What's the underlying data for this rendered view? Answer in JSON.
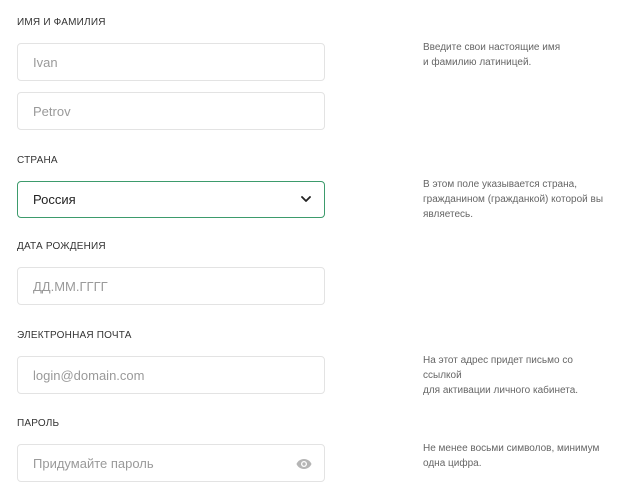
{
  "name_section": {
    "label": "ИМЯ И ФАМИЛИЯ",
    "first_name_placeholder": "Ivan",
    "last_name_placeholder": "Petrov",
    "hint": [
      "Введите свои настоящие имя",
      "и фамилию латиницей."
    ]
  },
  "country_section": {
    "label": "СТРАНА",
    "selected": "Россия",
    "hint": [
      "В этом поле указывается страна,",
      "гражданином (гражданкой) которой вы",
      "являетесь."
    ]
  },
  "birthdate_section": {
    "label": "ДАТА РОЖДЕНИЯ",
    "placeholder": "ДД.ММ.ГГГГ"
  },
  "email_section": {
    "label": "ЭЛЕКТРОННАЯ ПОЧТА",
    "placeholder": "login@domain.com",
    "hint": [
      "На этот адрес придет письмо со",
      "ссылкой",
      "для активации личного кабинета."
    ]
  },
  "password_section": {
    "label": "ПАРОЛЬ",
    "placeholder": "Придумайте пароль",
    "toggle_icon": "eye-icon",
    "hint": [
      "Не менее восьми символов, минимум",
      "одна цифра."
    ]
  },
  "colors": {
    "accent_border": "#3d9b6c",
    "field_border": "#e3e3e3"
  }
}
